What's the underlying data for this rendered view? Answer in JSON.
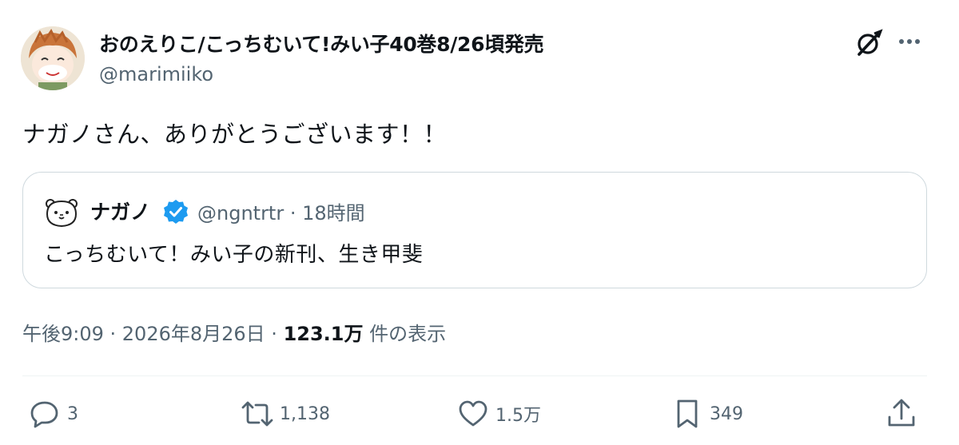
{
  "author": {
    "display_name": "おのえりこ/こっちむいて!みい子40巻8/26頃発売",
    "handle": "@marimiiko"
  },
  "tweet": {
    "text": "ナガノさん、ありがとうございます！！"
  },
  "quote": {
    "name": "ナガノ",
    "meta": "@ngntrtr · 18時間",
    "text": "こっちむいて！みい子の新刊、生き甲斐"
  },
  "timestamp": {
    "time_date": "午後9:09 · 2026年8月26日 · ",
    "views": "123.1万",
    "views_suffix": " 件の表示"
  },
  "actions": {
    "reply_count": "3",
    "retweet_count": "1,138",
    "like_count": "1.5万",
    "bookmark_count": "349"
  },
  "colors": {
    "text_primary": "#0f1419",
    "text_secondary": "#536471",
    "verified": "#1d9bf0",
    "border": "#cfd9de"
  },
  "icons": [
    "grok-icon",
    "more-icon",
    "verified-icon",
    "reply-icon",
    "retweet-icon",
    "like-icon",
    "bookmark-icon",
    "share-icon"
  ]
}
